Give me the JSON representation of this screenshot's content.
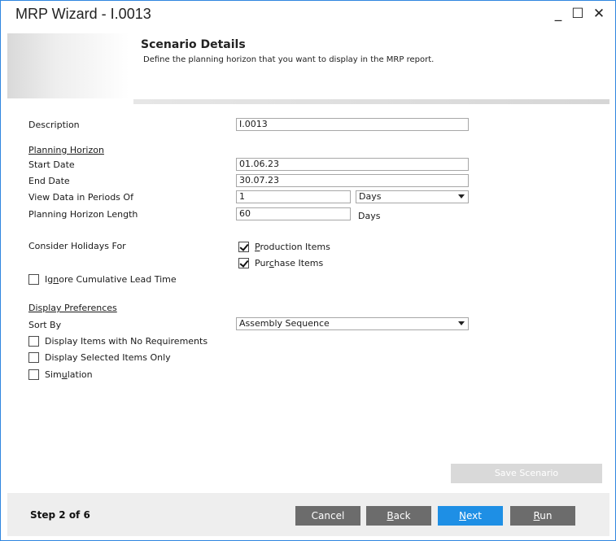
{
  "window": {
    "title": "MRP Wizard - I.0013",
    "minimize": "_",
    "maximize": "☐",
    "close": "✕"
  },
  "header": {
    "title": "Scenario Details",
    "subtitle": "Define the planning horizon that you want to display in the MRP report."
  },
  "form": {
    "description_label": "Description",
    "description_value": "I.0013",
    "planning_horizon_heading": "Planning Horizon",
    "start_date_label": "Start Date",
    "start_date_value": "01.06.23",
    "end_date_label": "End Date",
    "end_date_value": "30.07.23",
    "view_periods_label": "View Data in Periods Of",
    "view_periods_value": "1",
    "view_periods_unit": "Days",
    "horizon_length_label": "Planning Horizon Length",
    "horizon_length_value": "60",
    "horizon_length_unit": "Days",
    "holidays_label": "Consider Holidays For",
    "production_items": {
      "pre": "",
      "accel": "P",
      "post": "roduction Items",
      "checked": true
    },
    "purchase_items": {
      "pre": "Pur",
      "accel": "c",
      "post": "hase Items",
      "checked": true
    },
    "ignore_lead_time": {
      "pre": "Ig",
      "accel": "n",
      "post": "ore Cumulative Lead Time",
      "checked": false
    },
    "display_prefs_heading": "Display Preferences",
    "sort_by_label": "Sort By",
    "sort_by_value": "Assembly Sequence",
    "no_requirements": {
      "label": "Display Items with No Requirements",
      "checked": false
    },
    "selected_only": {
      "label": "Display Selected Items Only",
      "checked": false
    },
    "simulation": {
      "pre": "Sim",
      "accel": "u",
      "post": "lation",
      "checked": false
    }
  },
  "save_scenario_label": "Save Scenario",
  "footer": {
    "step_text": "Step 2 of 6",
    "cancel_label": "Cancel",
    "back": {
      "accel": "B",
      "post": "ack"
    },
    "next": {
      "accel": "N",
      "post": "ext"
    },
    "run": {
      "accel": "R",
      "post": "un"
    }
  },
  "colors": {
    "window_border": "#2f86e0",
    "primary_button": "#1e8fe5",
    "secondary_button": "#6c6c6c",
    "footer_bg": "#eeeeee",
    "disabled_button": "#d9d9d9"
  }
}
